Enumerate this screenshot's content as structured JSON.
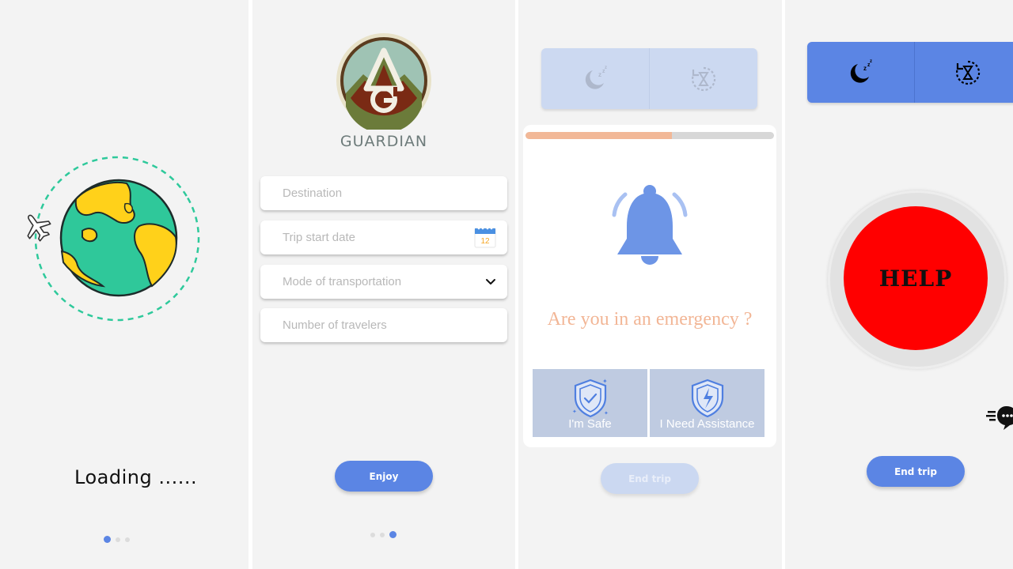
{
  "screen_loading": {
    "loading_text": "Loading ......",
    "page_indicator": {
      "count": 3,
      "active": 0
    }
  },
  "screen_plan": {
    "app_name": "GUARDIAN",
    "fields": {
      "destination_placeholder": "Destination",
      "trip_start_placeholder": "Trip start date",
      "transport_placeholder": "Mode of transportation",
      "travelers_placeholder": "Number of travelers"
    },
    "calendar_day": "12",
    "enjoy_label": "Enjoy",
    "page_indicator": {
      "count": 3,
      "active": 2
    }
  },
  "screen_check": {
    "tabs": [
      {
        "icon": "sleep-moon-icon"
      },
      {
        "icon": "timer-icon"
      }
    ],
    "progress": 0.59,
    "question": "Are you in an emergency ?",
    "safe_label": "I'm Safe",
    "assistance_label": "I Need Assistance",
    "end_trip_label": "End trip"
  },
  "screen_help": {
    "tabs": [
      {
        "icon": "sleep-moon-icon"
      },
      {
        "icon": "timer-icon"
      }
    ],
    "help_label": "HELP",
    "end_trip_label": "End trip"
  },
  "colors": {
    "primary": "#5b85e4",
    "primary_disabled": "#cbd8f1",
    "accent_peach": "#f2b696",
    "help_red": "#ff0000",
    "globe_green": "#2fc89a",
    "globe_yellow": "#ffd11a"
  }
}
